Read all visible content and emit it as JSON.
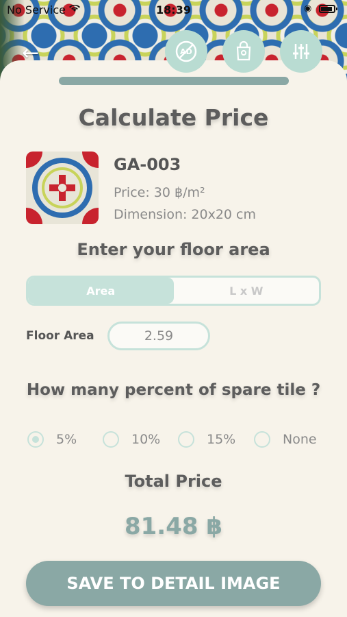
{
  "status_bar": {
    "carrier": "No Service",
    "time": "18:39"
  },
  "sheet": {
    "title": "Calculate Price",
    "product": {
      "code": "GA-003",
      "price_label": "Price:",
      "price_value": "30 ฿/m²",
      "dimension_label": "Dimension:",
      "dimension_value": "20x20 cm"
    },
    "floor_heading": "Enter your floor area",
    "segments": [
      {
        "label": "Area",
        "active": true
      },
      {
        "label": "L x W",
        "active": false
      }
    ],
    "floor_area_label": "Floor Area",
    "floor_area_value": "2.59",
    "spare_heading": "How many percent of spare tile ?",
    "spare_options": [
      {
        "label": "5%",
        "checked": true
      },
      {
        "label": "10%",
        "checked": false
      },
      {
        "label": "15%",
        "checked": false
      },
      {
        "label": "None",
        "checked": false
      }
    ],
    "total_heading": "Total Price",
    "total_value": "81.48 ฿",
    "save_label": "SAVE TO DETAIL IMAGE"
  },
  "colors": {
    "accent": "#8aa8a5",
    "accent_light": "#c6e2da",
    "sheet_bg": "#f7f3ea",
    "text_dark": "#5d5d5d",
    "text_muted": "#8a8a8a"
  },
  "icons": {
    "back": "back-arrow-icon",
    "no_ads": "no-ads-icon",
    "shop": "shopping-bag-location-icon",
    "filters": "sliders-icon",
    "wifi": "wifi-icon",
    "battery": "battery-icon"
  }
}
